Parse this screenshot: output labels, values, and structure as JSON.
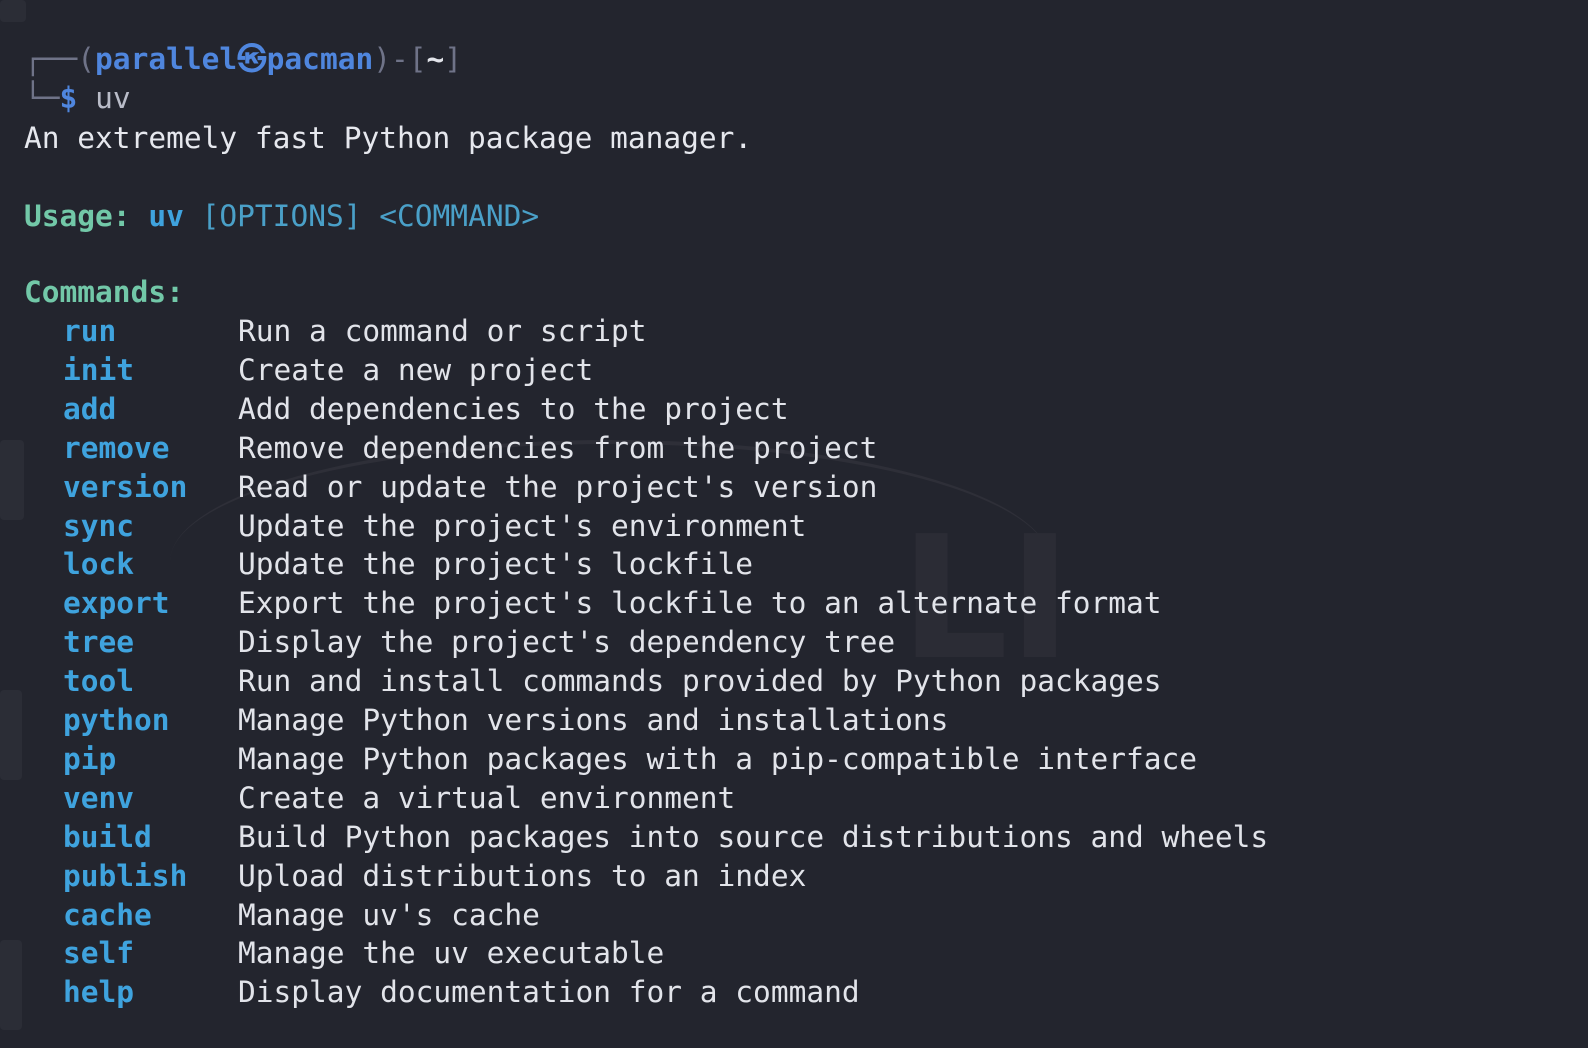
{
  "prompt": {
    "frame_top_left": "┌──(",
    "user": "parallel",
    "at_icon": "㉿",
    "host": "pacman",
    "frame_mid": ")-[",
    "cwd": "~",
    "frame_close": "]",
    "frame_bottom": "└─",
    "dollar": "$",
    "command": "uv"
  },
  "output": {
    "description": "An extremely fast Python package manager.",
    "usage_label": "Usage:",
    "usage_program": "uv",
    "usage_options": "[OPTIONS]",
    "usage_command": "<COMMAND>",
    "commands_heading": "Commands:",
    "commands": [
      {
        "name": "run",
        "description": "Run a command or script"
      },
      {
        "name": "init",
        "description": "Create a new project"
      },
      {
        "name": "add",
        "description": "Add dependencies to the project"
      },
      {
        "name": "remove",
        "description": "Remove dependencies from the project"
      },
      {
        "name": "version",
        "description": "Read or update the project's version"
      },
      {
        "name": "sync",
        "description": "Update the project's environment"
      },
      {
        "name": "lock",
        "description": "Update the project's lockfile"
      },
      {
        "name": "export",
        "description": "Export the project's lockfile to an alternate format"
      },
      {
        "name": "tree",
        "description": "Display the project's dependency tree"
      },
      {
        "name": "tool",
        "description": "Run and install commands provided by Python packages"
      },
      {
        "name": "python",
        "description": "Manage Python versions and installations"
      },
      {
        "name": "pip",
        "description": "Manage Python packages with a pip-compatible interface"
      },
      {
        "name": "venv",
        "description": "Create a virtual environment"
      },
      {
        "name": "build",
        "description": "Build Python packages into source distributions and wheels"
      },
      {
        "name": "publish",
        "description": "Upload distributions to an index"
      },
      {
        "name": "cache",
        "description": "Manage uv's cache"
      },
      {
        "name": "self",
        "description": "Manage the uv executable"
      },
      {
        "name": "help",
        "description": "Display documentation for a command"
      }
    ]
  },
  "colors": {
    "background": "#23252e",
    "prompt_blue": "#4f86de",
    "command_blue": "#3fa3de",
    "heading_green": "#72c8a8",
    "text": "#e2e4ea"
  }
}
